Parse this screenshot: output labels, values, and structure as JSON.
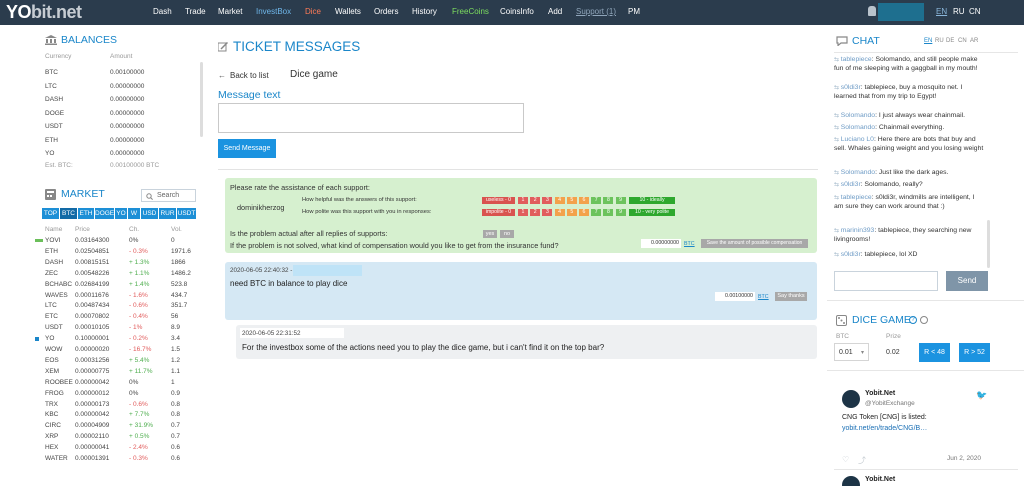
{
  "brand": {
    "logo_main": "YO",
    "logo_rest": "bit.net"
  },
  "nav": [
    "Dash",
    "Trade",
    "Market",
    "InvestBox",
    "Dice",
    "Wallets",
    "Orders",
    "History",
    "FreeCoins",
    "CoinsInfo",
    "Add",
    "Support (1)",
    "PM"
  ],
  "langs": [
    "EN",
    "RU",
    "CN"
  ],
  "balances": {
    "title": "BALANCES",
    "h_currency": "Currency",
    "h_amount": "Amount",
    "rows": [
      [
        "BTC",
        "0.00100000"
      ],
      [
        "LTC",
        "0.00000000"
      ],
      [
        "DASH",
        "0.00000000"
      ],
      [
        "DOGE",
        "0.00000000"
      ],
      [
        "USDT",
        "0.00000000"
      ],
      [
        "ETH",
        "0.00000000"
      ],
      [
        "YO",
        "0.00000000"
      ]
    ],
    "est_label": "Est. BTC:",
    "est_value": "0.00100000 BTC"
  },
  "market": {
    "title": "MARKET",
    "search_placeholder": "Search",
    "tabs": [
      "TOP",
      "BTC",
      "ETH",
      "DOGE",
      "YO",
      "W",
      "USD",
      "RUR",
      "USDT"
    ],
    "h_name": "Name",
    "h_price": "Price",
    "h_ch": "Ch.",
    "h_vol": "Vol.",
    "rows": [
      [
        "YOVI",
        "0.03164300",
        "0%",
        "0"
      ],
      [
        "ETH",
        "0.02504851",
        "- 0.3%",
        "1971.6"
      ],
      [
        "DASH",
        "0.00815151",
        "+ 1.3%",
        "1866"
      ],
      [
        "ZEC",
        "0.00548226",
        "+ 1.1%",
        "1486.2"
      ],
      [
        "BCHABC",
        "0.02684199",
        "+ 1.4%",
        "523.8"
      ],
      [
        "WAVES",
        "0.00011676",
        "- 1.6%",
        "434.7"
      ],
      [
        "LTC",
        "0.00487434",
        "- 0.6%",
        "351.7"
      ],
      [
        "ETC",
        "0.00070802",
        "- 0.4%",
        "56"
      ],
      [
        "USDT",
        "0.00010105",
        "- 1%",
        "8.9"
      ],
      [
        "YO",
        "0.10000001",
        "- 0.2%",
        "3.4"
      ],
      [
        "WOW",
        "0.00000020",
        "- 16.7%",
        "1.5"
      ],
      [
        "EOS",
        "0.00031256",
        "+ 5.4%",
        "1.2"
      ],
      [
        "XEM",
        "0.00000775",
        "+ 11.7%",
        "1.1"
      ],
      [
        "ROOBEE",
        "0.00000042",
        "0%",
        "1"
      ],
      [
        "FROG",
        "0.00000012",
        "0%",
        "0.9"
      ],
      [
        "TRX",
        "0.00000173",
        "- 0.6%",
        "0.8"
      ],
      [
        "KBC",
        "0.00000042",
        "+ 7.7%",
        "0.8"
      ],
      [
        "CIRC",
        "0.00004909",
        "+ 31.9%",
        "0.7"
      ],
      [
        "XRP",
        "0.00002110",
        "+ 0.5%",
        "0.7"
      ],
      [
        "HEX",
        "0.00000041",
        "- 2.4%",
        "0.6"
      ],
      [
        "WATER",
        "0.00001391",
        "- 0.3%",
        "0.6"
      ]
    ]
  },
  "ticket": {
    "title": "TICKET MESSAGES",
    "back": "Back to list",
    "subject": "Dice game",
    "msg_label": "Message text",
    "send": "Send Message",
    "rate_title": "Please rate the assistance of each support:",
    "agent": "dominikherzog",
    "q1": "How helpful was the answers of this support:",
    "q2": "How polite was this support with you in responses:",
    "useless": "useless - 0",
    "ideal": "10 - ideally",
    "impolite": "impolite - 0",
    "polite": "10 - very polite",
    "nums": [
      "1",
      "2",
      "3",
      "4",
      "5",
      "6",
      "7",
      "8",
      "9"
    ],
    "q3": "Is the problem actual after all replies of supports:",
    "yes": "yes",
    "no": "no",
    "q4": "If the problem is not solved, what kind of compensation would you like to get from the insurance fund?",
    "comp_value": "0.00000000",
    "comp_cur": "BTC",
    "comp_btn": "Save the amount of possible compensation",
    "m1_time": "2020-06-05 22:40:32 -",
    "m1_text": "need BTC in balance to play dice",
    "m1_value": "0.00100000",
    "m1_cur": "BTC",
    "m1_btn": "Say thanks",
    "m2_time": "2020-06-05 22:31:52",
    "m2_text": "For the investbox some of the actions need you to play the dice game, but i can't find it on the top bar?"
  },
  "chat": {
    "title": "CHAT",
    "langs": [
      "EN",
      "RU",
      "DE",
      "CN",
      "AR"
    ],
    "send": "Send",
    "messages": [
      {
        "n": "tablepiece",
        "t": ": Solomando, and still people make fun of me sleeping with a gaggball in my mouth!"
      },
      {
        "n": "s0ldi3r",
        "t": ": tablepiece, buy a mosquito net. I learned that from my trip to Egypt!"
      },
      {
        "n": "Solomando",
        "t": ": I just always wear chainmail."
      },
      {
        "n": "Solomando",
        "t": ": Chainmail everything."
      },
      {
        "n": "Luciano L0",
        "t": ": Here there are bots that buy and sell. Whales gaining weight and you losing weight"
      },
      {
        "n": "Solomando",
        "t": ": Just like the dark ages."
      },
      {
        "n": "s0ldi3r",
        "t": ": Solomando, really?"
      },
      {
        "n": "tablepiece",
        "t": ": s0ldi3r, windmills are intelligent, I am sure they can work around that :)"
      },
      {
        "n": "marinin393",
        "t": ": tablepiece, they searching new livingrooms!"
      },
      {
        "n": "s0ldi3r",
        "t": ": tablepiece, lol XD"
      }
    ]
  },
  "dice": {
    "title": "DICE GAME",
    "h_btc": "BTC",
    "h_prize": "Prize",
    "bet": "0.01",
    "prize": "0.02",
    "b1": "R < 48",
    "b2": "R > 52"
  },
  "tweet": {
    "name": "Yobit.Net",
    "handle": "@YobitExchange",
    "text": "CNG Token [CNG] is listed:",
    "link": "yobit.net/en/trade/CNG/B…",
    "date": "Jun 2, 2020",
    "name2": "Yobit.Net"
  },
  "colors": {
    "topbar": "#2b3c4d",
    "accent": "#1a86c9",
    "rate_red": "#d9534f",
    "rate_orange": "#f0ad4e",
    "rate_green": "#5cb85c"
  }
}
